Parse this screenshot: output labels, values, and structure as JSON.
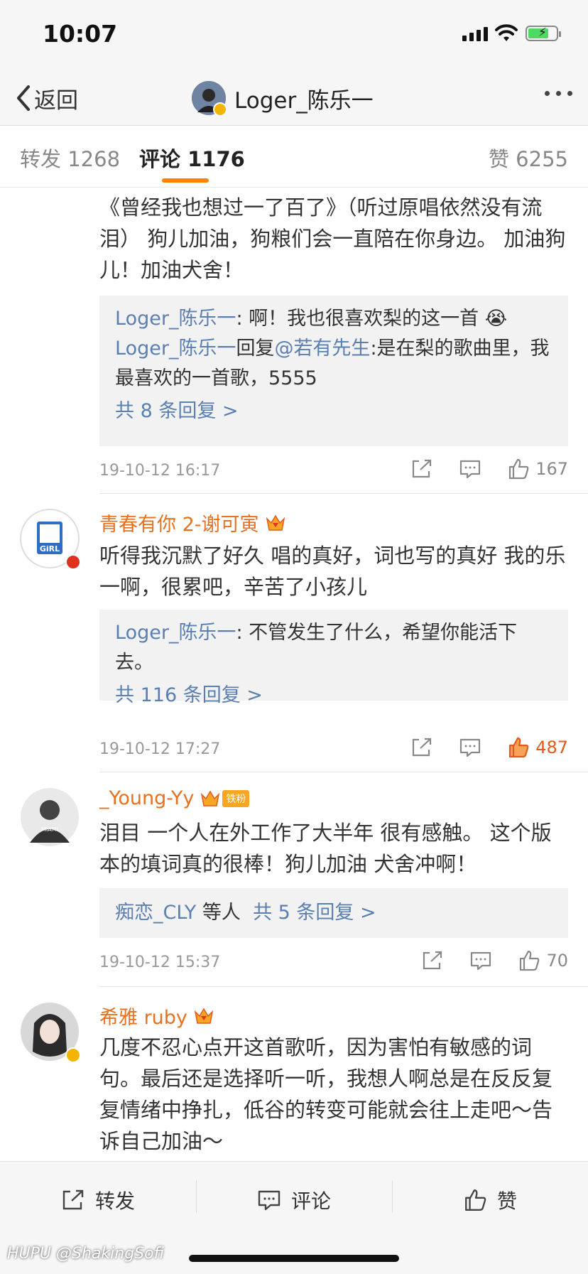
{
  "status": {
    "time": "10:07"
  },
  "nav": {
    "back_label": "返回",
    "title": "Loger_陈乐一"
  },
  "tabs": [
    {
      "label": "转发 1268"
    },
    {
      "label": "评论 1176"
    },
    {
      "label": "赞 6255"
    }
  ],
  "comments": [
    {
      "text": "《曾经我也想过一了百了》（听过原唱依然没有流泪） 狗儿加油，狗粮们会一直陪在你身边。 加油狗儿！加油犬舍！",
      "replies": [
        {
          "user": "Loger_陈乐一",
          "text": ": 啊！我也很喜欢梨的这一首 😭"
        },
        {
          "user": "Loger_陈乐一",
          "mid": "回复",
          "mention": "@若有先生",
          "text": ":是在梨的歌曲里，我最喜欢的一首歌，5555"
        }
      ],
      "more_replies": "共 8 条回复 >",
      "date": "19-10-12 16:17",
      "likes": "167"
    },
    {
      "username": "青春有你 2-谢可寅",
      "text": "听得我沉默了好久 唱的真好，词也写的真好 我的乐一啊，很累吧，辛苦了小孩儿",
      "replies": [
        {
          "user": "Loger_陈乐一",
          "text": ": 不管发生了什么，希望你能活下去。"
        }
      ],
      "more_replies": "共 116 条回复 >",
      "date": "19-10-12 17:27",
      "likes": "487"
    },
    {
      "username": "_Young-Yy",
      "badge_text": "铁粉",
      "text": "泪目 一个人在外工作了大半年 很有感触。 这个版本的填词真的很棒！狗儿加油 犬舍冲啊！",
      "reply_user": "痴恋_CLY",
      "reply_suffix": " 等人",
      "more_replies": "共 5 条回复 >",
      "date": "19-10-12 15:37",
      "likes": "70"
    },
    {
      "username": "希雅 ruby",
      "text": "几度不忍心点开这首歌听，因为害怕有敏感的词句。最后还是选择听一听，我想人啊总是在反反复复情绪中挣扎，低谷的转变可能就会往上走吧～告诉自己加油～"
    }
  ],
  "bottom": {
    "repost": "转发",
    "comment": "评论",
    "like": "赞"
  },
  "watermark": "HUPU @ShakingSofi",
  "colors": {
    "accent": "#ff8200",
    "link": "#5a7fb0",
    "username": "#e8711f",
    "like_hot": "#e35a1c"
  }
}
